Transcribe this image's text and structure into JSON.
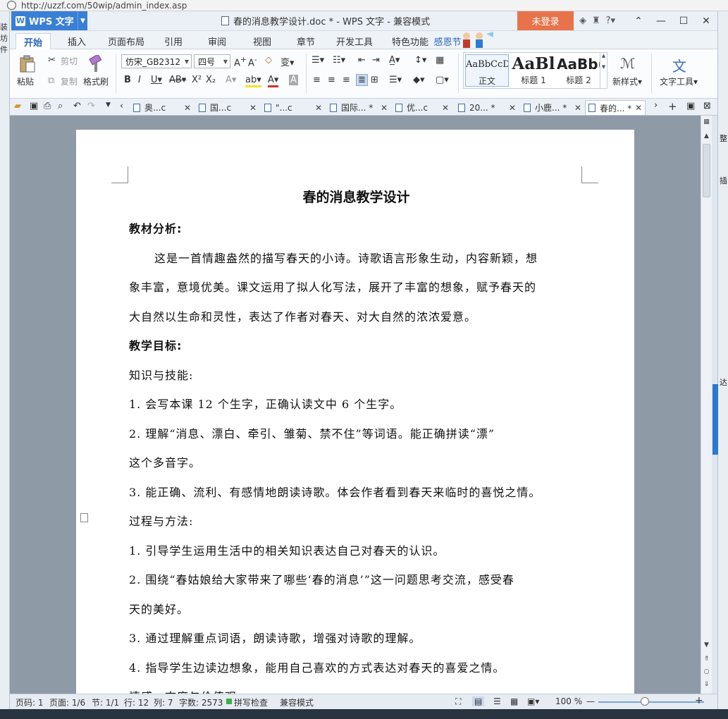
{
  "browser": {
    "url": "http://uzzf.com/50wip/admin_index.asp"
  },
  "left_fragments": [
    "装坊",
    "件"
  ],
  "right_fragments": [
    "整",
    "插",
    "达"
  ],
  "titlebar": {
    "app_name": "WPS 文字",
    "logo_letter": "W",
    "window_title": "春的消息教学设计.doc * - WPS 文字 - 兼容模式",
    "login_label": "未登录"
  },
  "menu": {
    "tabs": [
      "开始",
      "插入",
      "页面布局",
      "引用",
      "审阅",
      "视图",
      "章节",
      "开发工具",
      "特色功能"
    ],
    "festival_text": "感恩节"
  },
  "ribbon": {
    "paste": "粘贴",
    "cut": "剪切",
    "copy": "复制",
    "format_painter": "格式刷",
    "font_name": "仿宋_GB2312",
    "font_size": "四号",
    "styles": [
      {
        "preview": "AaBbCcD",
        "label": "正文"
      },
      {
        "preview": "AaBl",
        "label": "标题 1"
      },
      {
        "preview": "AaBb(",
        "label": "标题 2"
      }
    ],
    "new_style": "新样式",
    "text_tools": "文字工具"
  },
  "doc_tabs": [
    {
      "label": "奥...c"
    },
    {
      "label": "国...c"
    },
    {
      "label": "\"...c"
    },
    {
      "label": "国际... *"
    },
    {
      "label": "优...c"
    },
    {
      "label": "20... *"
    },
    {
      "label": "小鹿... *"
    },
    {
      "label": "春的... *"
    }
  ],
  "document": {
    "title": "春的消息教学设计",
    "lines": [
      {
        "text": "教材分析:",
        "style": "bold"
      },
      {
        "text": "这是一首情趣盎然的描写春天的小诗。诗歌语言形象生动，内容新颖，想",
        "style": "indent"
      },
      {
        "text": "象丰富，意境优美。课文运用了拟人化写法，展开了丰富的想象，赋予春天的",
        "style": "plain"
      },
      {
        "text": "大自然以生命和灵性，表达了作者对春天、对大自然的浓浓爱意。",
        "style": "plain"
      },
      {
        "text": "教学目标:",
        "style": "bold"
      },
      {
        "text": "知识与技能:",
        "style": "plain"
      },
      {
        "text": "1. 会写本课 12 个生字，正确认读文中 6 个生字。",
        "style": "plain"
      },
      {
        "text": "2. 理解“消息、漂白、牵引、雏菊、禁不住”等词语。能正确拼读“漂”",
        "style": "plain"
      },
      {
        "text": "这个多音字。",
        "style": "plain"
      },
      {
        "text": "3. 能正确、流利、有感情地朗读诗歌。体会作者看到春天来临时的喜悦之情。",
        "style": "plain"
      },
      {
        "text": "过程与方法:",
        "style": "plain"
      },
      {
        "text": "1. 引导学生运用生活中的相关知识表达自己对春天的认识。",
        "style": "plain"
      },
      {
        "text": "2. 围绕“春姑娘给大家带来了哪些‘春的消息’”这一问题思考交流，感受春",
        "style": "plain"
      },
      {
        "text": "天的美好。",
        "style": "plain"
      },
      {
        "text": "3. 通过理解重点词语，朗读诗歌，增强对诗歌的理解。",
        "style": "plain"
      },
      {
        "text": "4. 指导学生边读边想象，能用自己喜欢的方式表达对春天的喜爱之情。",
        "style": "plain"
      },
      {
        "text": "情感、态度与价值观:",
        "style": "plain"
      }
    ]
  },
  "status": {
    "page_num": "页码: 1",
    "pages": "页面: 1/6",
    "section": "节: 1/1",
    "row": "行: 12",
    "col": "列: 7",
    "word_count": "字数: 2573",
    "spell_check": "拼写检查",
    "compat_mode": "兼容模式",
    "zoom": "100 %"
  },
  "colors": {
    "accent": "#3a7fd6",
    "login": "#e8734a",
    "spell_ok": "#3bb04a"
  }
}
